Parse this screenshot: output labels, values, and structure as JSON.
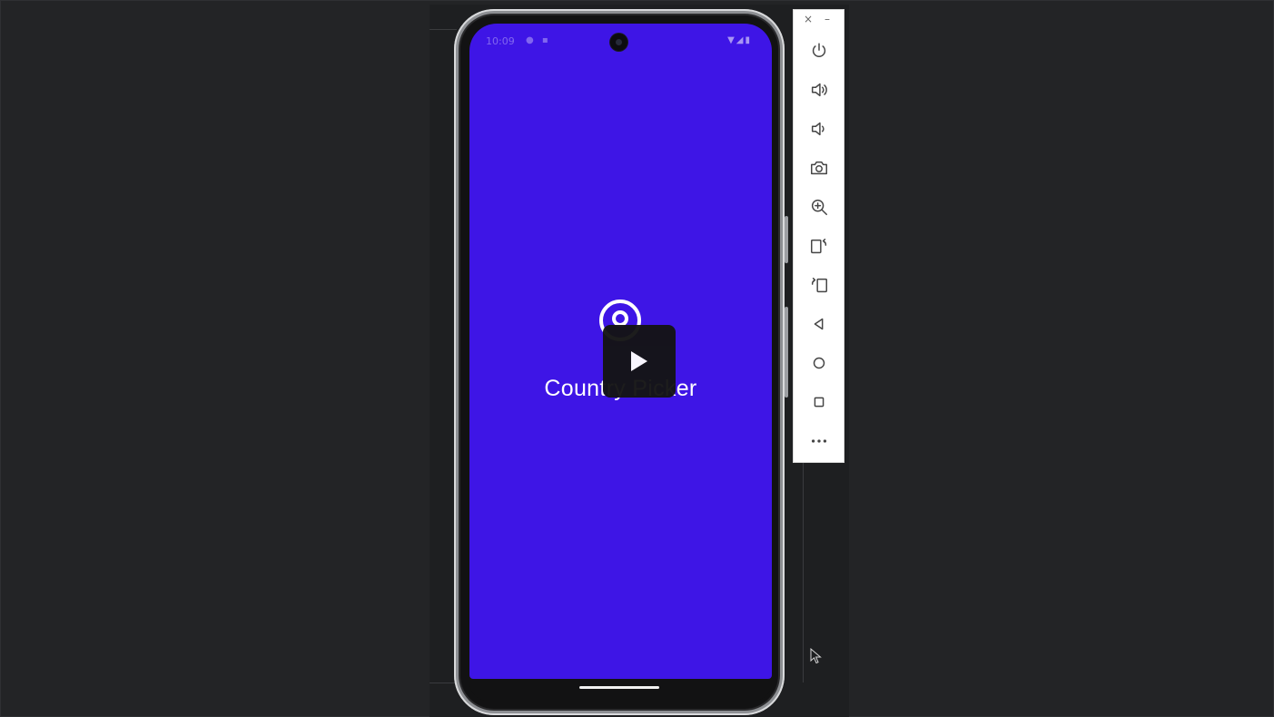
{
  "app": {
    "title": "Country Picker",
    "screen_color": "#3e15e6"
  },
  "status_bar": {
    "time": "10:09",
    "notification_icons": "● ▪",
    "system_icons": "▼◢▮"
  },
  "player": {
    "play_icon": "play-icon"
  },
  "toolbar": {
    "close_label": "×",
    "minimize_label": "–",
    "buttons": [
      "power-icon",
      "volume-up-icon",
      "volume-down-icon",
      "camera-icon",
      "zoom-icon",
      "rotate-left-icon",
      "rotate-right-icon",
      "back-icon",
      "home-icon",
      "overview-icon",
      "more-icon"
    ]
  },
  "colors": {
    "background": "#232426",
    "app_primary": "#3e15e6",
    "toolbar": "#ffffff"
  }
}
